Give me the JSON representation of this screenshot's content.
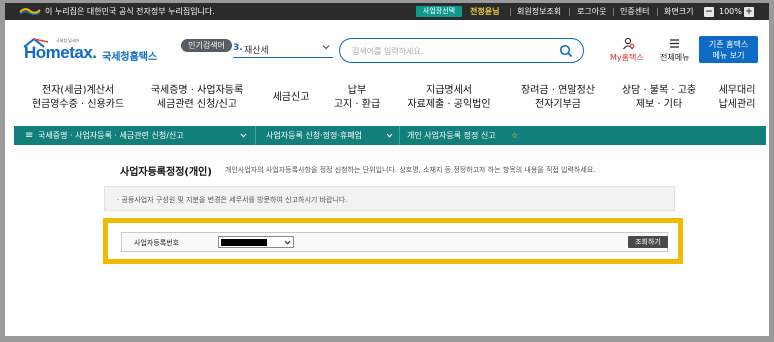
{
  "gov_bar": {
    "text": "이 누리집은 대한민국 공식 전자정부 누리집입니다.",
    "badge": "사업장선택",
    "user": "전정윤님",
    "links": [
      "회원정보조회",
      "로그아웃",
      "인증센터"
    ],
    "zoom_label": "화면크기",
    "zoom_value": "100%",
    "zoom_minus": "−",
    "zoom_plus": "+"
  },
  "header": {
    "logo_sub": "국세청 납세자",
    "logo_text": "Hometax.",
    "logo_kor": "국세청홈택스",
    "popular_label": "인기검색어",
    "rank_num": "3.",
    "rank_text": "재산세",
    "search_placeholder": "검색어를 입력하세요.",
    "my_hometax": "My홈택스",
    "all_menu": "전체메뉴",
    "classic_line1": "기존 홈택스",
    "classic_line2": "메뉴 보기"
  },
  "nav": [
    {
      "line1": "전자(세금)계산서",
      "line2": "현금영수증 · 신용카드"
    },
    {
      "line1": "국세증명 · 사업자등록",
      "line2": "세금관련 신청/신고"
    },
    {
      "line1": "세금신고",
      "line2": ""
    },
    {
      "line1": "납부",
      "line2": "고지 · 환급"
    },
    {
      "line1": "지급명세서",
      "line2": "자료제출 · 공익법인"
    },
    {
      "line1": "장려금 · 연말정산",
      "line2": "전자기부금"
    },
    {
      "line1": "상담 · 불복 · 고충",
      "line2": "제보 · 기타"
    },
    {
      "line1": "세무대리",
      "line2": "납세관리"
    }
  ],
  "breadcrumb": {
    "menu_glyph": "≡",
    "level1": "국세증명 · 사업자등록 · 세금관련 신청/신고",
    "level2": "사업자등록 신청·정정·휴폐업",
    "level3": "개인 사업자등록 정정 신고",
    "star": "☆"
  },
  "content": {
    "title": "사업자등록정정(개인)",
    "description": "개인사업자의 사업자등록사항을 정정 신청하는 단위입니다. 상호명, 소재지 등 정정하고자 하는 항목의 내용을 직접 입력하세요.",
    "notice": "· 공동사업자 구성원 및 지분을 변경은 세무서를 방문하여 신고하시기 바랍니다.",
    "field_label": "사업자등록번호",
    "query_button": "조회하기"
  },
  "colors": {
    "brand_blue": "#0d6bc6",
    "teal": "#137f7b",
    "highlight": "#f3b800",
    "my_red": "#d92c2c"
  }
}
